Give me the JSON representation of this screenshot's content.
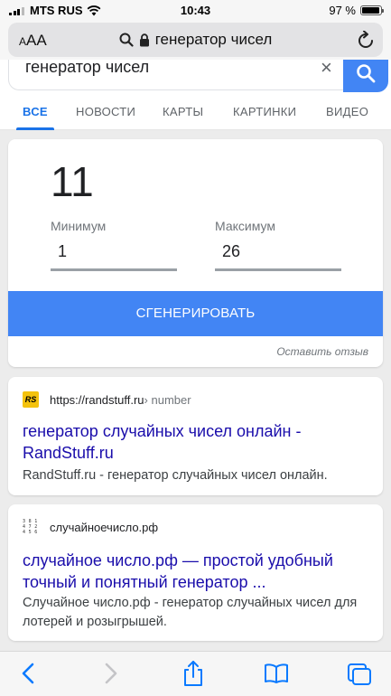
{
  "status_bar": {
    "carrier": "MTS RUS",
    "time": "10:43",
    "battery": "97 %",
    "battery_level": 0.97
  },
  "browser": {
    "font_size_label": "AA",
    "url_text": "генератор чисел"
  },
  "google": {
    "query": "генератор чисел",
    "tabs": [
      "ВСЕ",
      "НОВОСТИ",
      "КАРТЫ",
      "КАРТИНКИ",
      "ВИДЕО"
    ],
    "active_tab": "ВСЕ"
  },
  "rng": {
    "result": "11",
    "min_label": "Минимум",
    "min_value": "1",
    "max_label": "Максимум",
    "max_value": "26",
    "button_label": "СГЕНЕРИРОВАТЬ",
    "feedback_label": "Оставить отзыв"
  },
  "results": [
    {
      "favicon_text": "RS",
      "url": "https://randstuff.ru",
      "crumb": " › number",
      "title": "генератор случайных чисел онлайн - RandStuff.ru",
      "snippet": "RandStuff.ru - генератор случайных чисел онлайн."
    },
    {
      "url": "случайноечисло.рф",
      "title": "случайное число.рф — простой удобный точный и понятный генератор ...",
      "snippet": "Случайное число.рф - генератор случайных чисел для лотерей и розыгрышей."
    }
  ],
  "colors": {
    "accent": "#4285f4",
    "link": "#1a0dab",
    "tab_active": "#1a73e8",
    "ios_blue": "#0a7aff"
  }
}
